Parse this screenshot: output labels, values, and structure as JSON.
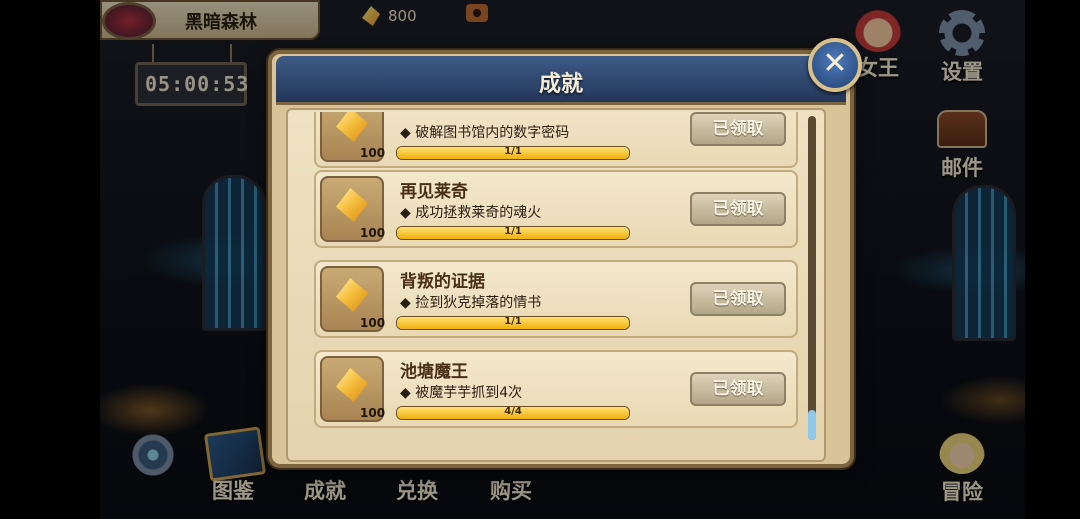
{
  "top": {
    "map_name": "黑暗森林",
    "gem_count": "800",
    "timer": "05:00:53"
  },
  "right_menu": {
    "king_label": "女王",
    "settings_label": "设置",
    "mail_label": "邮件",
    "adventure_label": "冒险"
  },
  "bottom_menu": {
    "codex_label": "图鉴",
    "achievements_label": "成就",
    "exchange_label": "兑换",
    "shop_label": "购买"
  },
  "modal": {
    "title": "成就",
    "close_symbol": "✕",
    "achievements": [
      {
        "title": "",
        "desc": "◆ 破解图书馆内的数字密码",
        "reward": "100",
        "progress_text": "1/1",
        "progress": 1.0,
        "button": "已领取"
      },
      {
        "title": "再见莱奇",
        "desc": "◆ 成功拯救莱奇的魂火",
        "reward": "100",
        "progress_text": "1/1",
        "progress": 1.0,
        "button": "已领取"
      },
      {
        "title": "背叛的证据",
        "desc": "◆ 捡到狄克掉落的情书",
        "reward": "100",
        "progress_text": "1/1",
        "progress": 1.0,
        "button": "已领取"
      },
      {
        "title": "池塘魔王",
        "desc": "◆ 被魔芋芋抓到4次",
        "reward": "100",
        "progress_text": "4/4",
        "progress": 1.0,
        "button": "已领取"
      }
    ]
  },
  "colors": {
    "header_blue": "#2f4a74",
    "parchment": "#e9d9b4",
    "progress_gold": "#f0b010"
  }
}
